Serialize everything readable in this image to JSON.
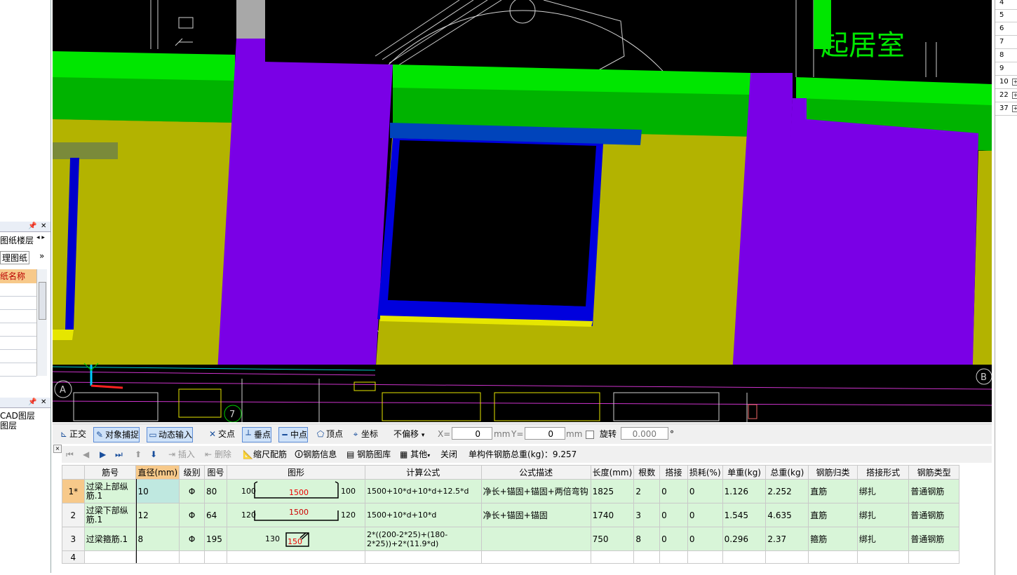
{
  "left_panel": {
    "panel1_tabs": [
      "图纸楼层",
      "理图纸"
    ],
    "panel1_header": "纸名称",
    "panel2_items": [
      "CAD图层",
      "图层"
    ]
  },
  "cad": {
    "room_label": "起居室",
    "axis_a": "A",
    "axis_b": "B",
    "axis_7": "7"
  },
  "right_numbers": [
    "4",
    "5",
    "6",
    "7",
    "8",
    "9",
    "10",
    "22",
    "37"
  ],
  "snap_toolbar": {
    "ortho": "正交",
    "object_snap": "对象捕捉",
    "dynamic_input": "动态输入",
    "intersection": "交点",
    "perpendicular": "垂点",
    "midpoint": "中点",
    "vertex": "顶点",
    "coordinate": "坐标",
    "offset_mode": "不偏移",
    "x_label": "X=",
    "x_value": "0",
    "unit_mm": "mm",
    "y_label": "Y=",
    "y_value": "0",
    "rotate_label": "旋转",
    "rotate_value": "0.000",
    "degree": "°"
  },
  "rebar_toolbar": {
    "insert": "插入",
    "delete": "删除",
    "scale": "缩尺配筋",
    "rebar_info": "钢筋信息",
    "rebar_lib": "钢筋图库",
    "other": "其他",
    "close": "关闭",
    "total_weight": "单构件钢筋总重(kg)：9.257"
  },
  "table": {
    "headers": [
      "",
      "筋号",
      "直径(mm)",
      "级别",
      "图号",
      "图形",
      "计算公式",
      "公式描述",
      "长度(mm)",
      "根数",
      "搭接",
      "损耗(%)",
      "单重(kg)",
      "总重(kg)",
      "钢筋归类",
      "搭接形式",
      "钢筋类型"
    ],
    "rows": [
      {
        "no": "1*",
        "name": "过梁上部纵筋.1",
        "dia": "10",
        "grade": "Φ",
        "fig": "80",
        "shape_left": "100",
        "shape_mid": "1500",
        "shape_right": "100",
        "formula": "1500+10*d+10*d+12.5*d",
        "desc": "净长+锚固+锚固+两倍弯钩",
        "length": "1825",
        "count": "2",
        "lap": "0",
        "loss": "0",
        "unit_w": "1.126",
        "total_w": "2.252",
        "category": "直筋",
        "lap_type": "绑扎",
        "type": "普通钢筋"
      },
      {
        "no": "2",
        "name": "过梁下部纵筋.1",
        "dia": "12",
        "grade": "Φ",
        "fig": "64",
        "shape_left": "120",
        "shape_mid": "1500",
        "shape_right": "120",
        "formula": "1500+10*d+10*d",
        "desc": "净长+锚固+锚固",
        "length": "1740",
        "count": "3",
        "lap": "0",
        "loss": "0",
        "unit_w": "1.545",
        "total_w": "4.635",
        "category": "直筋",
        "lap_type": "绑扎",
        "type": "普通钢筋"
      },
      {
        "no": "3",
        "name": "过梁箍筋.1",
        "dia": "8",
        "grade": "Φ",
        "fig": "195",
        "shape_left": "130",
        "shape_mid": "150",
        "shape_right": "",
        "formula": "2*((200-2*25)+(180-2*25))+2*(11.9*d)",
        "desc": "",
        "length": "750",
        "count": "8",
        "lap": "0",
        "loss": "0",
        "unit_w": "0.296",
        "total_w": "2.37",
        "category": "箍筋",
        "lap_type": "绑扎",
        "type": "普通钢筋"
      }
    ],
    "empty_row_no": "4"
  }
}
